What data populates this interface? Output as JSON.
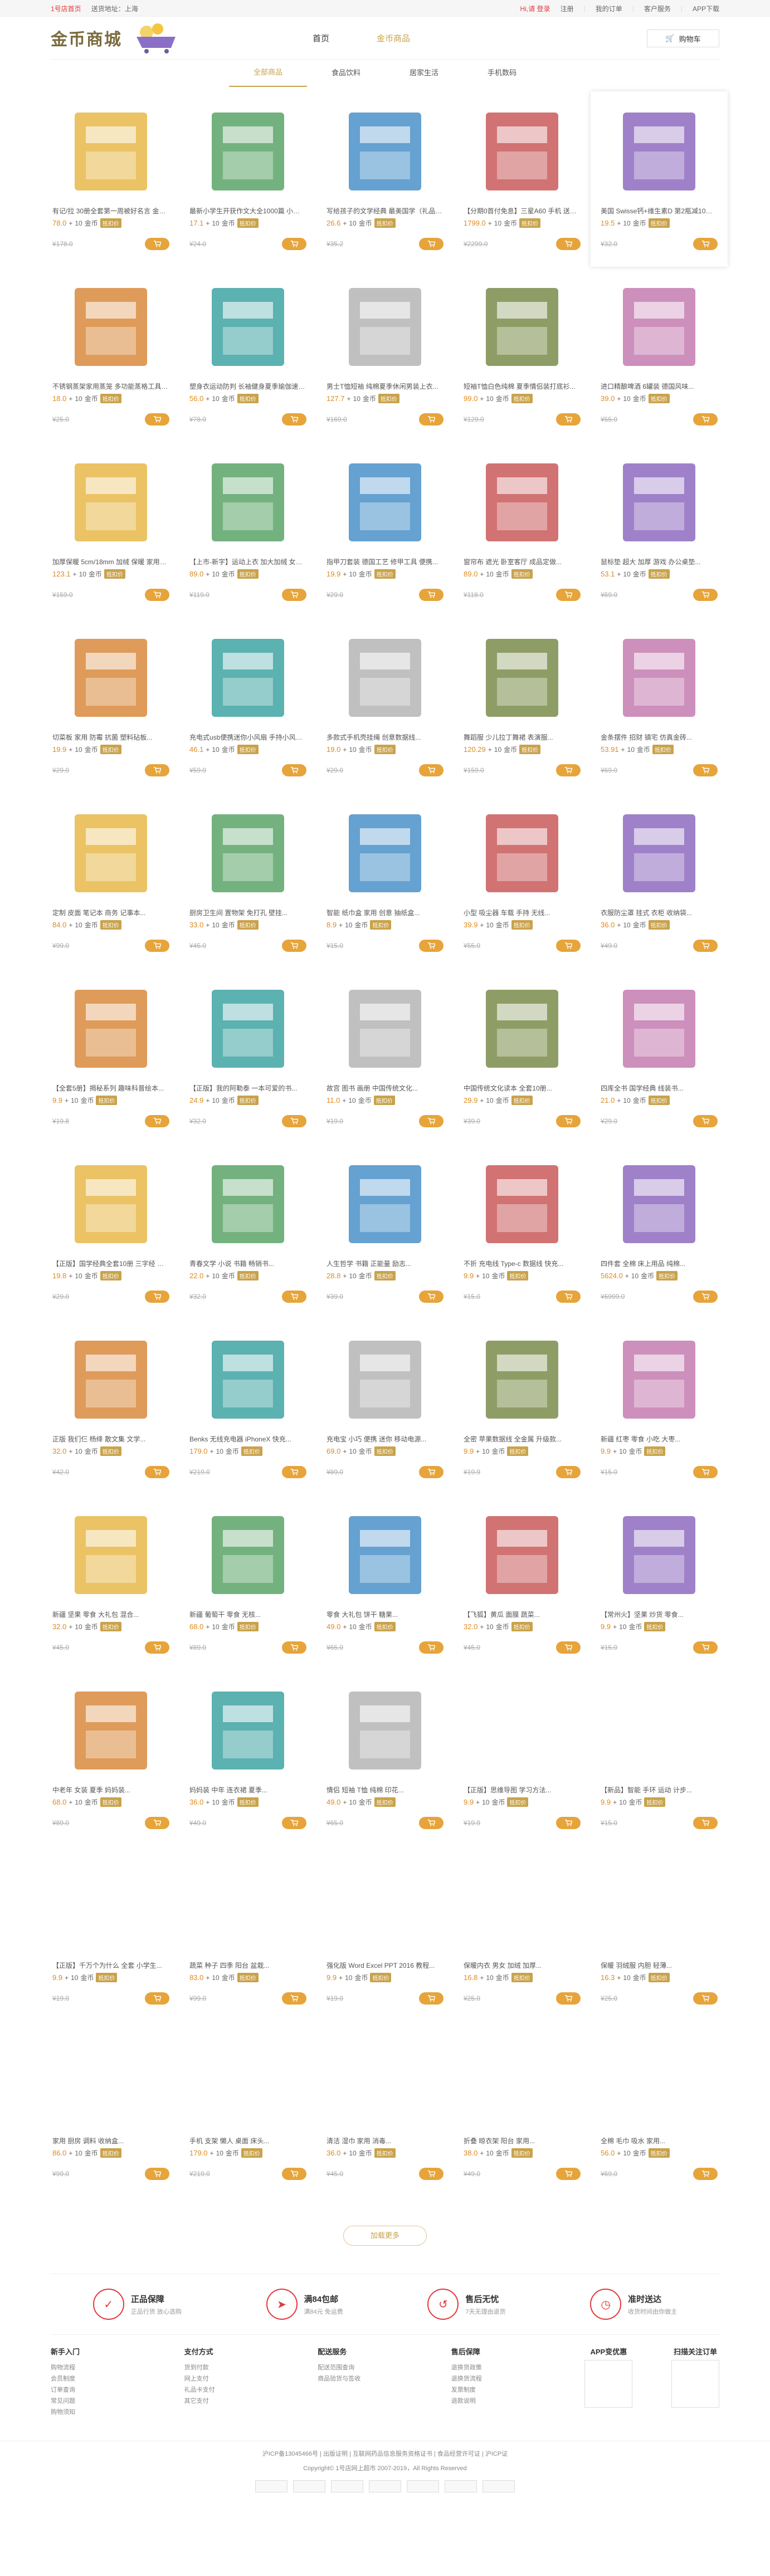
{
  "topbar": {
    "home": "1号店首页",
    "location": "送货地址：上海",
    "login": "Hi,请 登录",
    "register": "注册",
    "orders": "我的订单",
    "service": "客户服务",
    "app": "APP下载"
  },
  "header": {
    "logo": "金币商城",
    "nav": [
      "首页",
      "金币商品"
    ],
    "cart": "购物车"
  },
  "subnav": [
    "全部商品",
    "食品饮料",
    "居家生活",
    "手机数码"
  ],
  "products": [
    {
      "title": "有记/拉 30册全套第一周被好名言 金融后类成功的...",
      "price": "78.0",
      "coin": "10",
      "orig": "¥178.0"
    },
    {
      "title": "最新小学生开获作文大全1000篇 小学生优秀作文...",
      "price": "17.1",
      "coin": "10",
      "orig": "¥24.0"
    },
    {
      "title": "写给孩子的文学经典 最美国学（礼品套装）...",
      "price": "26.6",
      "coin": "10",
      "orig": "¥35.2"
    },
    {
      "title": "【分期0首付免息】三星A60 手机 送充电器 全面屏...",
      "price": "1799.0",
      "coin": "10",
      "orig": "¥2299.0"
    },
    {
      "title": "美国 Swisse钙+维生素D 第2瓶减10元 儿童...",
      "price": "19.5",
      "coin": "10",
      "orig": "¥32.0"
    },
    {
      "title": "不锈钢蒸架家用蒸笼 多功能蒸格工具 可折叠...",
      "price": "18.0",
      "coin": "10",
      "orig": "¥25.0"
    },
    {
      "title": "塑身衣运动防判 长袖健身夏季瑜伽速干上衣...",
      "price": "56.0",
      "coin": "10",
      "orig": "¥78.0"
    },
    {
      "title": "男士T恤短袖 纯棉夏季休闲男装上衣...",
      "price": "127.7",
      "coin": "10",
      "orig": "¥169.0"
    },
    {
      "title": "短袖T恤白色纯棉 夏季情侣装打底衫...",
      "price": "99.0",
      "coin": "10",
      "orig": "¥129.0"
    },
    {
      "title": "进口精酿啤酒 6罐装 德国风味...",
      "price": "39.0",
      "coin": "10",
      "orig": "¥55.0"
    },
    {
      "title": "加厚保暖 5cm/18mm 加绒 保暖 家用地暖...",
      "price": "123.1",
      "coin": "10",
      "orig": "¥159.0"
    },
    {
      "title": "【上市-新字】运动上衣 加大加绒 女士...",
      "price": "89.0",
      "coin": "10",
      "orig": "¥119.0"
    },
    {
      "title": "指甲刀套装 德国工艺 修甲工具 便携...",
      "price": "19.9",
      "coin": "10",
      "orig": "¥29.0"
    },
    {
      "title": "窗帘布 遮光 卧室客厅 成品定做...",
      "price": "89.0",
      "coin": "10",
      "orig": "¥118.0"
    },
    {
      "title": "鼠标垫 超大 加厚 游戏 办公桌垫...",
      "price": "53.1",
      "coin": "10",
      "orig": "¥69.0"
    },
    {
      "title": "切菜板 家用 防霉 抗菌 塑料砧板...",
      "price": "19.9",
      "coin": "10",
      "orig": "¥29.0"
    },
    {
      "title": "充电式usb便携迷你小风扇 手持小风扇...",
      "price": "46.1",
      "coin": "10",
      "orig": "¥59.0"
    },
    {
      "title": "多款式手机壳挂绳 创意数据线...",
      "price": "19.0",
      "coin": "10",
      "orig": "¥29.0"
    },
    {
      "title": "舞蹈服 少儿拉丁舞裙 表演服...",
      "price": "120.29",
      "coin": "10",
      "orig": "¥159.0"
    },
    {
      "title": "金条摆件 招财 镇宅 仿真金砖...",
      "price": "53.91",
      "coin": "10",
      "orig": "¥69.0"
    },
    {
      "title": "定制 皮面 笔记本 商务 记事本...",
      "price": "84.0",
      "coin": "10",
      "orig": "¥99.0"
    },
    {
      "title": "厨房卫生间 置物架 免打孔 壁挂...",
      "price": "33.0",
      "coin": "10",
      "orig": "¥45.0"
    },
    {
      "title": "智能 纸巾盒 家用 创意 抽纸盒...",
      "price": "8.9",
      "coin": "10",
      "orig": "¥15.0"
    },
    {
      "title": "小型 吸尘器 车载 手持 无线...",
      "price": "39.9",
      "coin": "10",
      "orig": "¥55.0"
    },
    {
      "title": "衣服防尘罩 挂式 衣柜 收纳袋...",
      "price": "36.0",
      "coin": "10",
      "orig": "¥49.0"
    },
    {
      "title": "【全套5册】揭秘系列 趣味科普绘本...",
      "price": "9.9",
      "coin": "10",
      "orig": "¥19.8"
    },
    {
      "title": "【正版】我的阿勒泰 一本可爱的书...",
      "price": "24.9",
      "coin": "10",
      "orig": "¥32.0"
    },
    {
      "title": "故宫 图书 画册 中国传统文化...",
      "price": "11.0",
      "coin": "10",
      "orig": "¥19.0"
    },
    {
      "title": "中国传统文化读本 全套10册...",
      "price": "29.9",
      "coin": "10",
      "orig": "¥39.0"
    },
    {
      "title": "四库全书 国学经典 线装书...",
      "price": "21.0",
      "coin": "10",
      "orig": "¥29.0"
    },
    {
      "title": "【正版】国学经典全套10册 三字经 弟子规...",
      "price": "19.8",
      "coin": "10",
      "orig": "¥29.0"
    },
    {
      "title": "青春文学 小说 书籍 畅销书...",
      "price": "22.0",
      "coin": "10",
      "orig": "¥32.0"
    },
    {
      "title": "人生哲学 书籍 正能量 励志...",
      "price": "28.8",
      "coin": "10",
      "orig": "¥39.0"
    },
    {
      "title": "不折 充电线 Type-c 数据线 快充...",
      "price": "9.9",
      "coin": "10",
      "orig": "¥15.0"
    },
    {
      "title": "四件套 全棉 床上用品 纯棉...",
      "price": "5624.0",
      "coin": "10",
      "orig": "¥6999.0"
    },
    {
      "title": "正版 我们仨 杨绛 散文集 文学...",
      "price": "32.0",
      "coin": "10",
      "orig": "¥42.0"
    },
    {
      "title": "Benks 无线充电器 iPhoneX 快充...",
      "price": "179.0",
      "coin": "10",
      "orig": "¥219.0"
    },
    {
      "title": "充电宝 小巧 便携 迷你 移动电源...",
      "price": "69.0",
      "coin": "10",
      "orig": "¥89.0"
    },
    {
      "title": "全密 苹果数据线 全金属 升级款...",
      "price": "9.9",
      "coin": "10",
      "orig": "¥19.9"
    },
    {
      "title": "新疆 红枣 零食 小吃 大枣...",
      "price": "9.9",
      "coin": "10",
      "orig": "¥15.0"
    },
    {
      "title": "新疆 坚果 零食 大礼包 混合...",
      "price": "32.0",
      "coin": "10",
      "orig": "¥45.0"
    },
    {
      "title": "新疆 葡萄干 零食 无核...",
      "price": "68.0",
      "coin": "10",
      "orig": "¥89.0"
    },
    {
      "title": "零食 大礼包 饼干 糖果...",
      "price": "49.0",
      "coin": "10",
      "orig": "¥65.0"
    },
    {
      "title": "【飞狐】黄瓜 面膜 蔬菜...",
      "price": "32.0",
      "coin": "10",
      "orig": "¥45.0"
    },
    {
      "title": "【常州火】坚果 炒货 零食...",
      "price": "9.9",
      "coin": "10",
      "orig": "¥15.0"
    },
    {
      "title": "中老年 女装 夏季 妈妈装...",
      "price": "68.0",
      "coin": "10",
      "orig": "¥89.0"
    },
    {
      "title": "妈妈装 中年 连衣裙 夏季...",
      "price": "36.0",
      "coin": "10",
      "orig": "¥49.0"
    },
    {
      "title": "情侣 短袖 T恤 纯棉 印花...",
      "price": "49.0",
      "coin": "10",
      "orig": "¥65.0"
    },
    {
      "title": "【正版】思维导图 学习方法...",
      "price": "9.9",
      "coin": "10",
      "orig": "¥19.9"
    },
    {
      "title": "【新品】智能 手环 运动 计步...",
      "price": "9.9",
      "coin": "10",
      "orig": "¥15.0"
    },
    {
      "title": "【正版】千万个为什么 全套 小学生...",
      "price": "9.9",
      "coin": "10",
      "orig": "¥19.0"
    },
    {
      "title": "蔬菜 种子 四季 阳台 盆栽...",
      "price": "83.0",
      "coin": "10",
      "orig": "¥99.0"
    },
    {
      "title": "强化版 Word Excel PPT 2016 教程...",
      "price": "9.9",
      "coin": "10",
      "orig": "¥19.0"
    },
    {
      "title": "保暖内衣 男女 加绒 加厚...",
      "price": "16.8",
      "coin": "10",
      "orig": "¥25.0"
    },
    {
      "title": "保暖 羽绒服 内胆 轻薄...",
      "price": "16.3",
      "coin": "10",
      "orig": "¥25.0"
    },
    {
      "title": "家用 厨房 调料 收纳盒...",
      "price": "86.0",
      "coin": "10",
      "orig": "¥99.0"
    },
    {
      "title": "手机 支架 懒人 桌面 床头...",
      "price": "179.0",
      "coin": "10",
      "orig": "¥219.0"
    },
    {
      "title": "清洁 湿巾 家用 消毒...",
      "price": "36.0",
      "coin": "10",
      "orig": "¥45.0"
    },
    {
      "title": "折叠 晾衣架 阳台 家用...",
      "price": "38.0",
      "coin": "10",
      "orig": "¥49.0"
    },
    {
      "title": "全棉 毛巾 吸水 家用...",
      "price": "56.0",
      "coin": "10",
      "orig": "¥69.0"
    }
  ],
  "load_more": "加载更多",
  "services": [
    {
      "t1": "正品保障",
      "t2": "正品行货 放心选购"
    },
    {
      "t1": "满84包邮",
      "t2": "满84元 免运费"
    },
    {
      "t1": "售后无忧",
      "t2": "7天无理由退货"
    },
    {
      "t1": "准时送达",
      "t2": "收货时间由你做主"
    }
  ],
  "footer": {
    "cols": [
      {
        "h": "新手入门",
        "items": [
          "购物流程",
          "会员制度",
          "订单查询",
          "常见问题",
          "购物须知"
        ]
      },
      {
        "h": "支付方式",
        "items": [
          "货到付款",
          "网上支付",
          "礼品卡支付",
          "其它支付"
        ]
      },
      {
        "h": "配送服务",
        "items": [
          "配送范围查询",
          "商品验货与签收"
        ]
      },
      {
        "h": "售后保障",
        "items": [
          "退换货政策",
          "退换货流程",
          "发票制度",
          "退款说明"
        ]
      }
    ],
    "qr1": "APP变优惠",
    "qr2": "扫描关注订单",
    "copyright1": "沪ICP备13045466号 | 出版证明 | 互联网药品信息服务资格证书 | 食品经营许可证 | 沪ICP证",
    "copyright2": "Copyright© 1号店网上超市 2007-2019，All Rights Reserved"
  }
}
